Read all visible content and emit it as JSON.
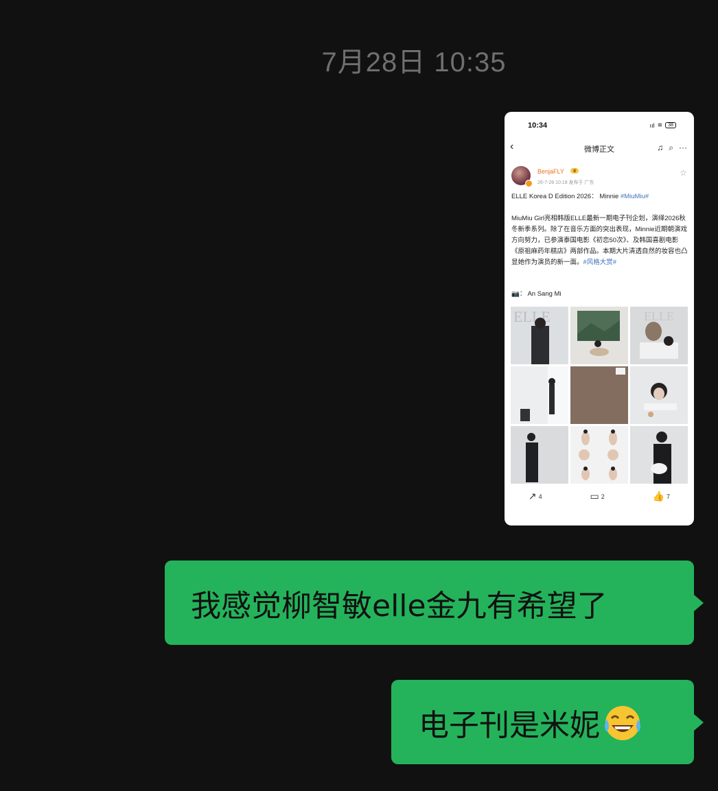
{
  "chat": {
    "timestamp": "7月28日 10:35",
    "messages": [
      {
        "text": "我感觉柳智敏elle金九有希望了"
      },
      {
        "text": "电子刊是米妮",
        "emoji": "face-with-tears-of-joy"
      }
    ]
  },
  "screenshot": {
    "status_time": "10:34",
    "status_signal": "ııl",
    "status_battery": "38",
    "nav_title": "微博正文",
    "user": {
      "name": "BenjaFLY",
      "badge": "♛",
      "meta": "26-7-28 10:18  发布于 广东"
    },
    "post": {
      "line1": "ELLE Korea D Edition 2026： Minnie ",
      "line1_tag": "#MiuMiu#",
      "body": "MiuMiu Girl亮相韩版ELLE最新一期电子刊企划，演绎2026秋冬新季系列。除了在音乐方面的突出表现，Minnie近期朝演戏方向努力，已参演泰国电影《初恋50次》、及韩国喜剧电影《原祖麻药年糕店》两部作品。本期大片清透自然的妆容也凸显她作为演员的新一面。",
      "body_tag": "#风格大赏#",
      "credit": "📷： An Sang Mi"
    },
    "actions": {
      "repost": "4",
      "comment": "2",
      "like": "7"
    },
    "colors": {
      "accent": "#3f73b5",
      "username": "#e8731e"
    }
  },
  "colors": {
    "bubble": "#24b35b",
    "background": "#111111",
    "timestamp": "#6f6f6f"
  }
}
